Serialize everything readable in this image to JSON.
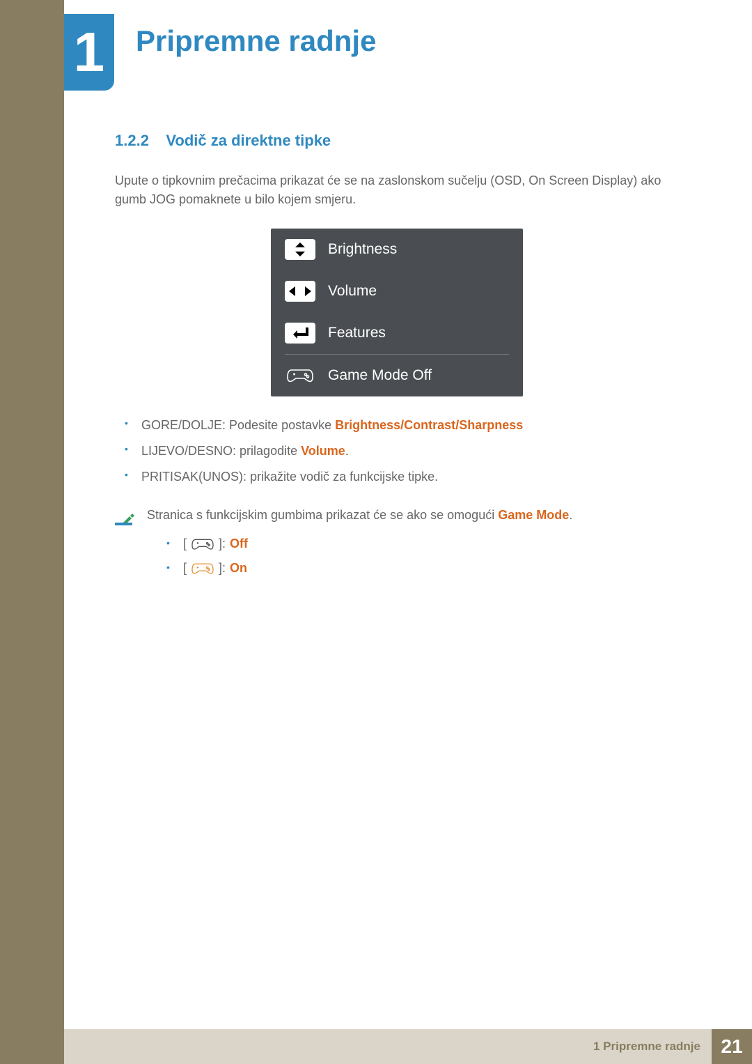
{
  "header": {
    "chapter_number": "1",
    "chapter_title": "Pripremne radnje"
  },
  "section": {
    "number": "1.2.2",
    "title": "Vodič za direktne tipke",
    "intro": "Upute o tipkovnim prečacima prikazat će se na zaslonskom sučelju (OSD, On Screen Display) ako gumb JOG pomaknete u bilo kojem smjeru."
  },
  "osd": {
    "rows": [
      {
        "icon": "updown",
        "label": "Brightness"
      },
      {
        "icon": "leftright",
        "label": "Volume"
      },
      {
        "icon": "enter",
        "label": "Features"
      },
      {
        "icon": "controller",
        "label": "Game Mode Off"
      }
    ]
  },
  "bullets": [
    {
      "prefix": "GORE/DOLJE: Podesite postavke ",
      "hl": [
        "Brightness",
        "Contrast",
        "Sharpness"
      ],
      "sep": "/"
    },
    {
      "prefix": "LIJEVO/DESNO: prilagodite ",
      "hl_single": "Volume",
      "suffix": "."
    },
    {
      "plain": "PRITISAK(UNOS): prikažite vodič za funkcijske tipke."
    }
  ],
  "note": {
    "text_prefix": "Stranica s funkcijskim gumbima prikazat će se ako se omogući ",
    "text_hl": "Game Mode",
    "text_suffix": ".",
    "items": [
      {
        "icon_style": "outline",
        "label": "Off"
      },
      {
        "icon_style": "orange",
        "label": "On"
      }
    ]
  },
  "footer": {
    "label": "1 Pripremne radnje",
    "page": "21"
  }
}
